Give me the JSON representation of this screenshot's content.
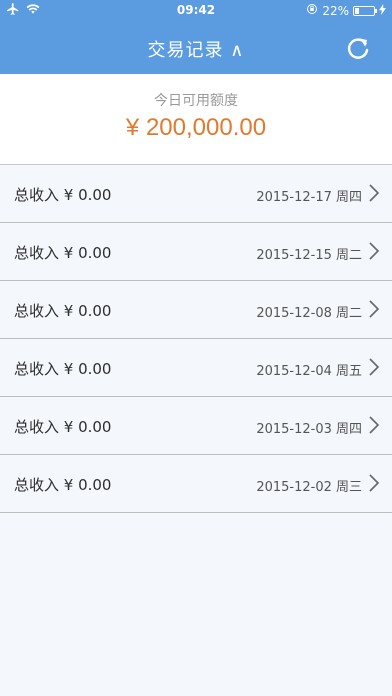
{
  "status_bar": {
    "time": "09:42",
    "battery_text": "22%",
    "battery_level": 0.22,
    "airplane_icon": "airplane-icon",
    "wifi_icon": "wifi-icon",
    "lock_rotation_icon": "orientation-lock-icon",
    "charging_icon": "charging-bolt-icon"
  },
  "nav": {
    "title": "交易记录 ∧",
    "refresh_icon": "refresh-icon"
  },
  "summary": {
    "label": "今日可用额度",
    "amount": "¥ 200,000.00"
  },
  "records": [
    {
      "income": "总收入 ¥ 0.00",
      "date": "2015-12-17 周四"
    },
    {
      "income": "总收入 ¥ 0.00",
      "date": "2015-12-15 周二"
    },
    {
      "income": "总收入 ¥ 0.00",
      "date": "2015-12-08 周二"
    },
    {
      "income": "总收入 ¥ 0.00",
      "date": "2015-12-04 周五"
    },
    {
      "income": "总收入 ¥ 0.00",
      "date": "2015-12-03 周四"
    },
    {
      "income": "总收入 ¥ 0.00",
      "date": "2015-12-02 周三"
    }
  ],
  "colors": {
    "header_blue": "#5b9bdf",
    "amount_orange": "#e07a2f",
    "list_background": "#f4f7fb"
  }
}
